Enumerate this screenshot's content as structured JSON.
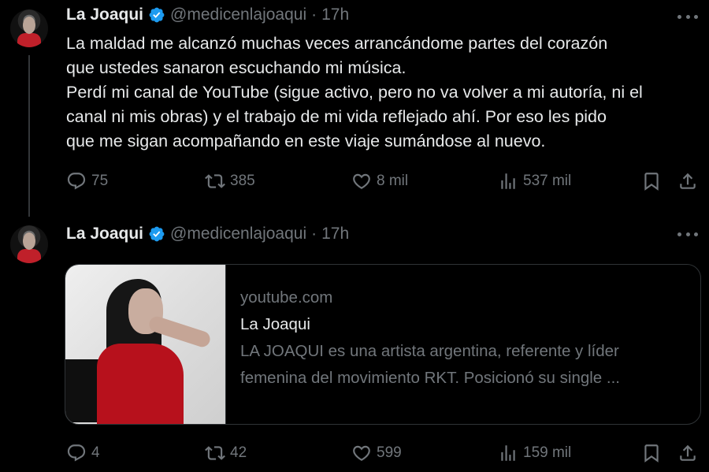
{
  "tweets": [
    {
      "author": {
        "name": "La Joaqui",
        "handle": "@medicenlajoaqui",
        "time": "17h"
      },
      "text": [
        "La maldad me alcanzó muchas veces arrancándome partes del corazón",
        "que ustedes sanaron escuchando mi música.",
        "Perdí mi canal de YouTube (sigue activo, pero no va volver a mi autoría, ni el",
        "canal ni mis obras)  y el trabajo de mi vida reflejado ahí.  Por eso les pido",
        "que me sigan acompañando en este viaje sumándose al nuevo."
      ],
      "stats": {
        "replies": "75",
        "reposts": "385",
        "likes": "8 mil",
        "views": "537 mil"
      }
    },
    {
      "author": {
        "name": "La Joaqui",
        "handle": "@medicenlajoaqui",
        "time": "17h"
      },
      "card": {
        "domain": "youtube.com",
        "title": "La Joaqui",
        "description": [
          "LA JOAQUI es una artista argentina, referente y líder",
          "femenina del movimiento RKT. Posicionó su single ..."
        ]
      },
      "stats": {
        "replies": "4",
        "reposts": "42",
        "likes": "599",
        "views": "159 mil"
      }
    }
  ],
  "icons": {
    "verified": "verified-badge-icon",
    "reply": "reply-icon",
    "repost": "repost-icon",
    "like": "heart-icon",
    "views": "views-icon",
    "bookmark": "bookmark-icon",
    "share": "share-icon",
    "more": "more-icon"
  },
  "colors": {
    "background": "#000000",
    "text": "#e7e9ea",
    "muted": "#71767b",
    "verified": "#1d9bf0",
    "border": "#2f3336"
  }
}
